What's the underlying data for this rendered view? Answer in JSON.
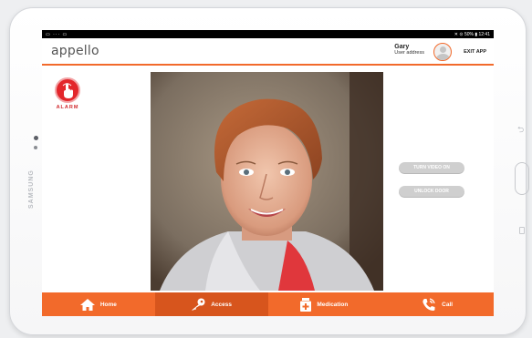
{
  "device": {
    "brand": "SAMSUNG"
  },
  "statusbar": {
    "left_icons": "▭ ··· ▭",
    "right_text": "✕ ⊙ 50% ▮ 12:41"
  },
  "header": {
    "logo": "appello",
    "user_name": "Gary",
    "user_address": "User address",
    "exit_label": "EXIT APP"
  },
  "alarm": {
    "label": "ALARM",
    "icon": "hand-pointer-icon"
  },
  "video_controls": {
    "turn_video_label": "TURN VIDEO ON",
    "unlock_door_label": "UNLOCK DOOR"
  },
  "nav": {
    "active": "Access",
    "items": [
      {
        "label": "Home",
        "icon": "home-icon"
      },
      {
        "label": "Access",
        "icon": "key-icon"
      },
      {
        "label": "Medication",
        "icon": "medication-icon"
      },
      {
        "label": "Call",
        "icon": "phone-icon"
      }
    ]
  },
  "colors": {
    "accent": "#f26a2b",
    "accent_active": "#d7551d",
    "alarm": "#e3262b",
    "button_grey": "#cfcfcf"
  }
}
